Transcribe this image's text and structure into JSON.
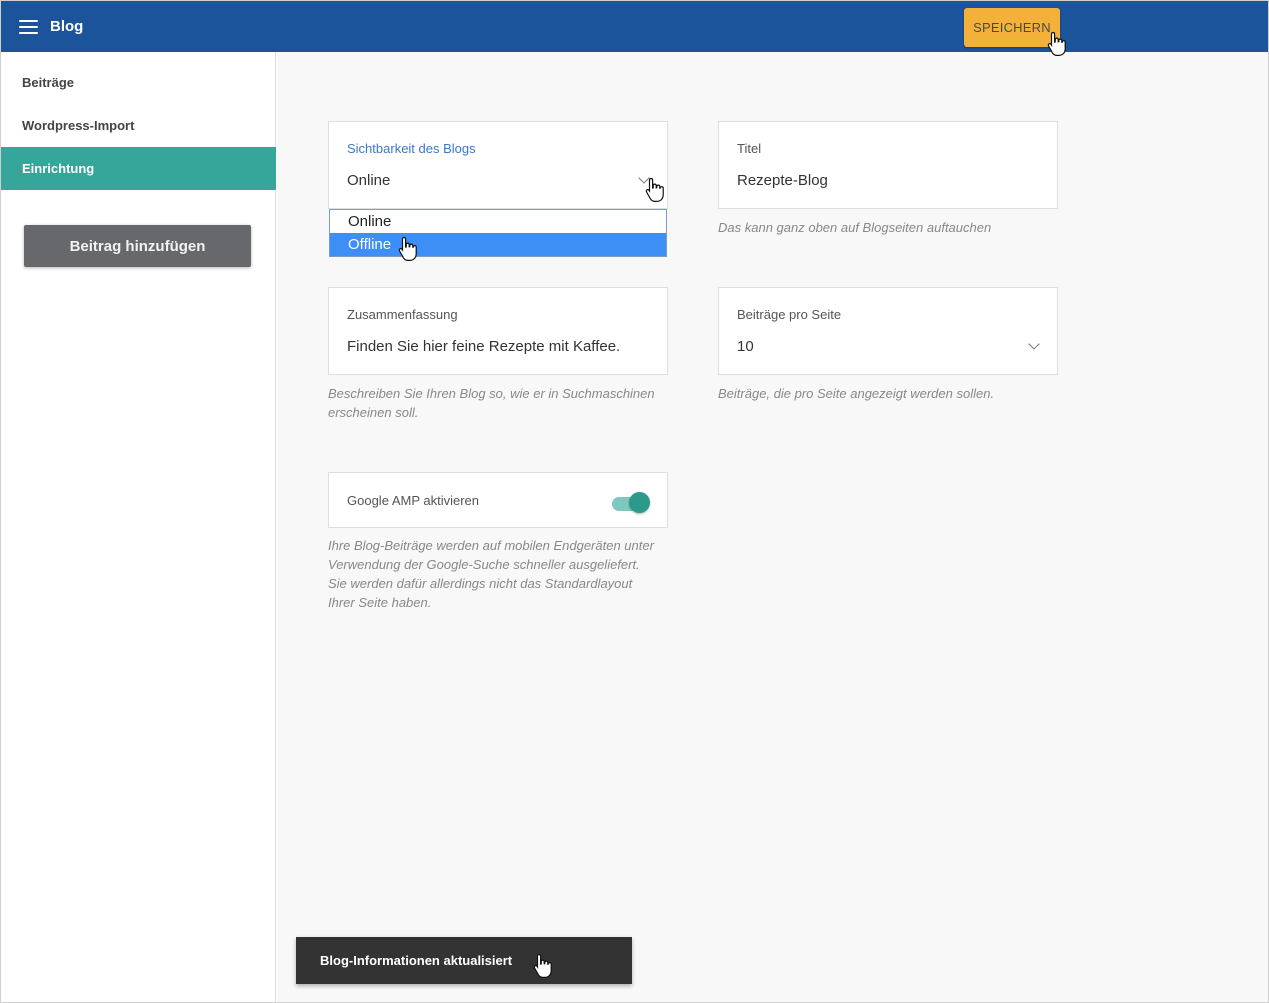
{
  "header": {
    "title": "Blog",
    "save_label": "SPEICHERN",
    "bg_color": "#1c549b",
    "save_color": "#f3b13a"
  },
  "sidebar": {
    "items": [
      {
        "label": "Beiträge",
        "active": false
      },
      {
        "label": "Wordpress-Import",
        "active": false
      },
      {
        "label": "Einrichtung",
        "active": true
      }
    ],
    "add_post_label": "Beitrag hinzufügen",
    "active_color": "#36a59a"
  },
  "settings": {
    "visibility": {
      "label": "Sichtbarkeit des Blogs",
      "value": "Online",
      "options": [
        "Online",
        "Offline"
      ],
      "highlighted_option": "Offline"
    },
    "title": {
      "label": "Titel",
      "value": "Rezepte-Blog",
      "helper": "Das kann ganz oben auf Blogseiten auftauchen"
    },
    "summary": {
      "label": "Zusammenfassung",
      "value": "Finden Sie hier feine Rezepte mit Kaffee.",
      "helper_line1": "Beschreiben Sie Ihren Blog so, wie er in Suchmaschinen",
      "helper_line2": "erscheinen soll."
    },
    "posts_per_page": {
      "label": "Beiträge pro Seite",
      "value": "10",
      "helper": "Beiträge, die pro Seite angezeigt werden sollen."
    },
    "amp": {
      "label": "Google AMP aktivieren",
      "enabled": true,
      "helper_lines": [
        "Ihre Blog-Beiträge werden auf mobilen Endgeräten unter",
        "Verwendung der Google-Suche schneller ausgeliefert.",
        "Sie werden dafür allerdings nicht das Standardlayout",
        "Ihrer Seite haben."
      ]
    }
  },
  "snackbar": {
    "message": "Blog-Informationen aktualisiert"
  },
  "icons": [
    "menu-icon",
    "chevron-down-icon",
    "hand-cursor-icon"
  ]
}
